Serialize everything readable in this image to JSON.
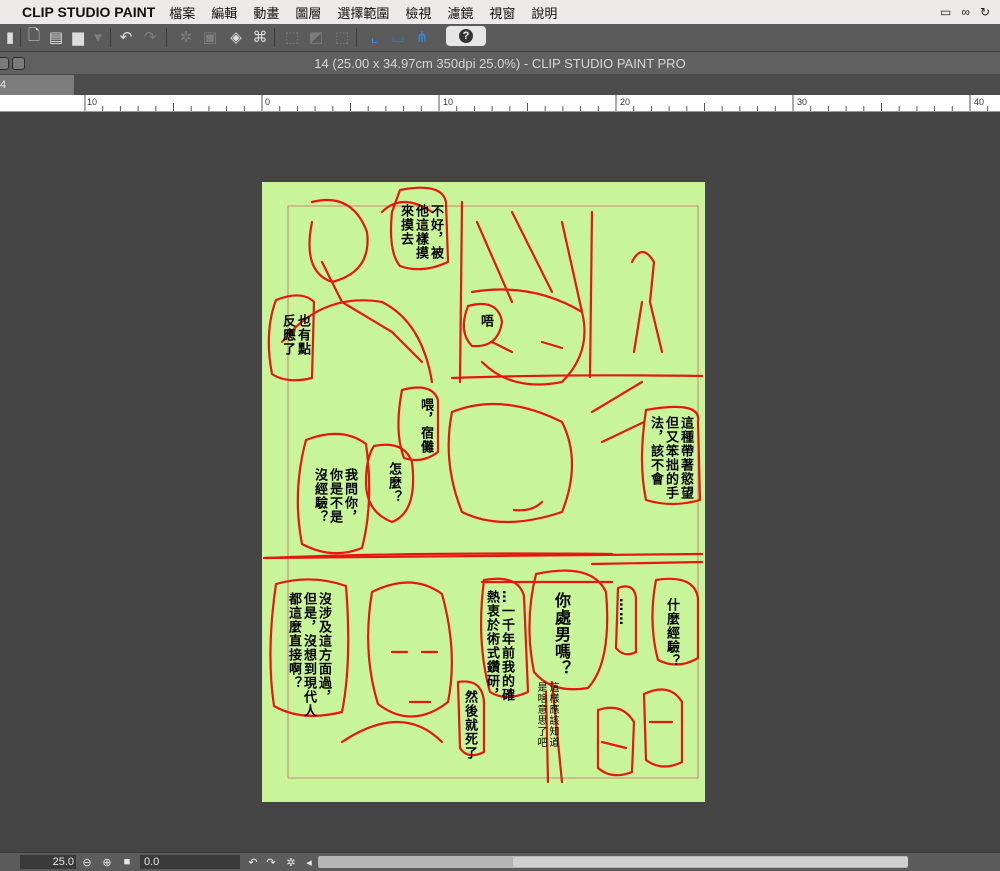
{
  "menubar": {
    "app_name": "CLIP STUDIO PAINT",
    "items": [
      "檔案",
      "編輯",
      "動畫",
      "圖層",
      "選擇範圍",
      "檢視",
      "濾鏡",
      "視窗",
      "說明"
    ]
  },
  "toolbar": {
    "help_label": "?"
  },
  "window": {
    "title": "14 (25.00 x 34.97cm 350dpi 25.0%)  - CLIP STUDIO PAINT PRO",
    "tab_label": "4"
  },
  "ruler": {
    "labels": [
      "10",
      "0",
      "10",
      "20",
      "30",
      "40"
    ]
  },
  "canvas": {
    "page_color": "#c8f59a",
    "sketch_color": "#e8160f",
    "balloons": {
      "b1": "不好，被\n他這樣摸\n來摸去",
      "b2": "唔",
      "b3": "也有點\n反應了",
      "b4": "喂，宿儺",
      "b5": "這種帶著慾望\n但又笨拙的手\n法，該不會",
      "b6": "我問你，\n你是不是\n沒經驗？",
      "b7": "怎麼？",
      "b8": "……",
      "b9": "什麼經驗？",
      "b10": "你處男嗎？",
      "b11": "這樣應該知道\n是啥意思了吧",
      "b12": "…一千年前我的確\n熱衷於術式鑽研，",
      "b13": "然後就死了",
      "b14": "沒涉及這方面過，\n但是，沒想到現代人\n都這麼直接啊？"
    }
  },
  "statusbar": {
    "zoom": "25.0",
    "rotation": "0.0"
  }
}
